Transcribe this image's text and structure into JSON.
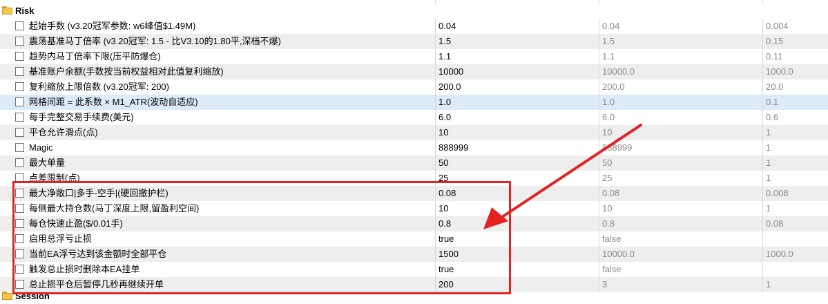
{
  "groups": {
    "risk": "Risk",
    "session": "Session"
  },
  "rows": [
    {
      "name": "起始手数 (v3.20冠军参数: w6峰值$1.49M)",
      "value": "0.04",
      "default": "0.04",
      "step": "0.004"
    },
    {
      "name": "震荡基准马丁倍率 (v3.20冠军: 1.5 - 比V3.10的1.80平,深档不爆)",
      "value": "1.5",
      "default": "1.5",
      "step": "0.15"
    },
    {
      "name": "趋势内马丁倍率下限(压平防爆仓)",
      "value": "1.1",
      "default": "1.1",
      "step": "0.11"
    },
    {
      "name": "基准账户余额(手数按当前权益相对此值复利缩放)",
      "value": "10000",
      "default": "10000.0",
      "step": "1000.0"
    },
    {
      "name": "复利缩放上限倍数 (v3.20冠军: 200)",
      "value": "200.0",
      "default": "200.0",
      "step": "20.0"
    },
    {
      "name": "网格间距 = 此系数 × M1_ATR(波动自适应)",
      "value": "1.0",
      "default": "1.0",
      "step": "0.1"
    },
    {
      "name": "每手完整交易手续费(美元)",
      "value": "6.0",
      "default": "6.0",
      "step": "0.6"
    },
    {
      "name": "平仓允许滑点(点)",
      "value": "10",
      "default": "10",
      "step": "1"
    },
    {
      "name": "Magic",
      "value": "888999",
      "default": "888999",
      "step": "1"
    },
    {
      "name": "最大单量",
      "value": "50",
      "default": "50",
      "step": "1"
    },
    {
      "name": "点差限制(点)",
      "value": "25",
      "default": "25",
      "step": "1"
    },
    {
      "name": "最大净敞口|多手-空手|(硬回撤护栏)",
      "value": "0.08",
      "default": "0.08",
      "step": "0.008"
    },
    {
      "name": "每侧最大持仓数(马丁深度上限,留盈利空间)",
      "value": "10",
      "default": "10",
      "step": "1"
    },
    {
      "name": "每仓快速止盈($/0.01手)",
      "value": "0.8",
      "default": "0.8",
      "step": "0.08"
    },
    {
      "name": "启用总浮亏止损",
      "value": "true",
      "default": "false",
      "step": ""
    },
    {
      "name": "当前EA浮亏达到该金额时全部平仓",
      "value": "1500",
      "default": "10000.0",
      "step": "1000.0"
    },
    {
      "name": "触发总止损时删除本EA挂单",
      "value": "true",
      "default": "false",
      "step": ""
    },
    {
      "name": "总止损平仓后暂停几秒再继续开单",
      "value": "200",
      "default": "3",
      "step": "1"
    }
  ],
  "colors": {
    "highlight_box": "#e52222",
    "selected_row": "#ddebf8"
  }
}
